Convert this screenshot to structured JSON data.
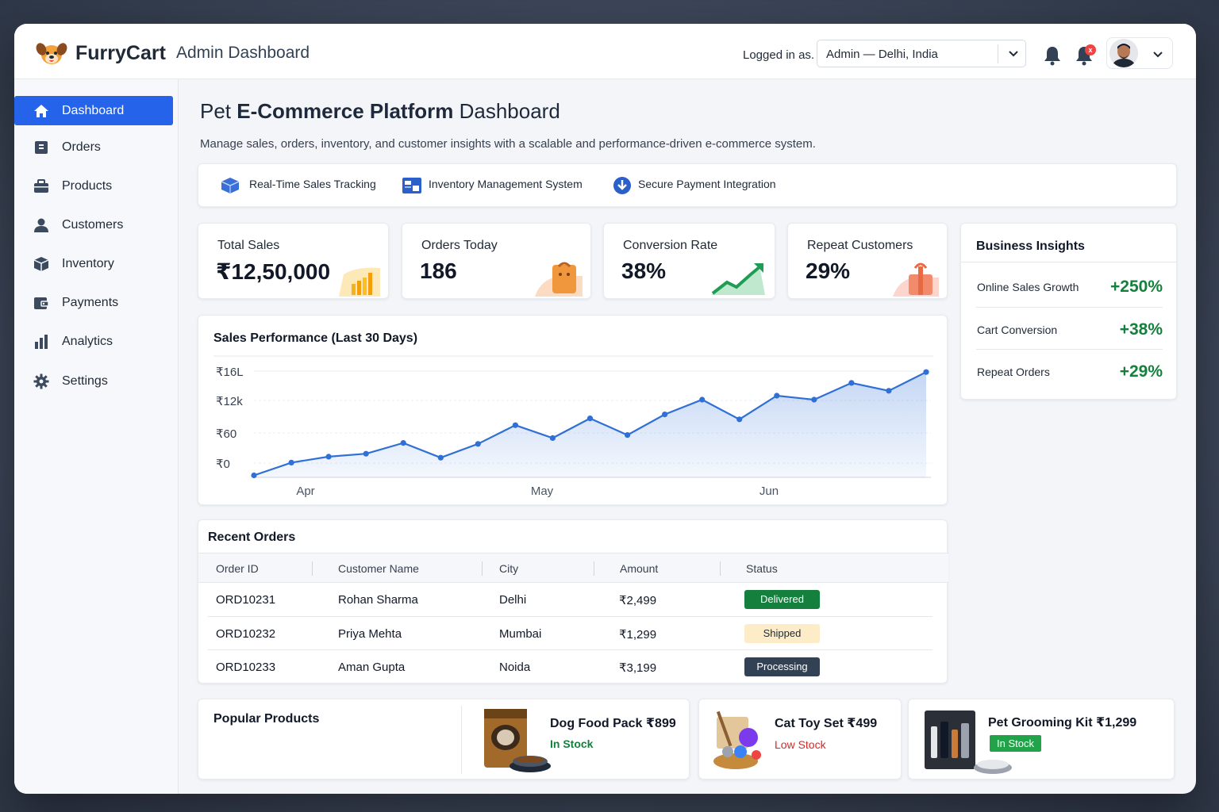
{
  "header": {
    "brand": "FurryCart",
    "subtitle": "Admin Dashboard",
    "logged_in_label": "Logged in as.",
    "location_value": "Admin — Delhi, India",
    "notification_badge": "x"
  },
  "sidebar": {
    "items": [
      {
        "label": "Dashboard",
        "icon": "home-icon",
        "active": true
      },
      {
        "label": "Orders",
        "icon": "orders-icon"
      },
      {
        "label": "Products",
        "icon": "briefcase-icon"
      },
      {
        "label": "Customers",
        "icon": "user-icon"
      },
      {
        "label": "Inventory",
        "icon": "box-icon"
      },
      {
        "label": "Payments",
        "icon": "wallet-icon"
      },
      {
        "label": "Analytics",
        "icon": "bar-chart-icon"
      },
      {
        "label": "Settings",
        "icon": "gear-icon"
      }
    ]
  },
  "page": {
    "title_prefix": "Pet",
    "title_bold": "E-Commerce Platform",
    "title_suffix": "Dashboard",
    "subtitle": "Manage sales, orders, inventory, and customer insights with a scalable and performance-driven e-commerce system."
  },
  "features": [
    {
      "label": "Real-Time Sales Tracking",
      "icon": "cube-icon"
    },
    {
      "label": "Inventory Management System",
      "icon": "inventory-icon"
    },
    {
      "label": "Secure Payment Integration",
      "icon": "download-circle-icon"
    }
  ],
  "kpis": [
    {
      "label": "Total Sales",
      "value": "₹12,50,000"
    },
    {
      "label": "Orders Today",
      "value": "186"
    },
    {
      "label": "Conversion Rate",
      "value": "38%"
    },
    {
      "label": "Repeat Customers",
      "value": "29%"
    }
  ],
  "insights": {
    "title": "Business Insights",
    "rows": [
      {
        "label": "Online Sales Growth",
        "value": "+250%"
      },
      {
        "label": "Cart Conversion",
        "value": "+38%"
      },
      {
        "label": "Repeat Orders",
        "value": "+29%"
      }
    ]
  },
  "chart_data": {
    "type": "area",
    "title": "Sales Performance (Last 30 Days)",
    "y_tick_labels": [
      "₹16L",
      "₹12k",
      "₹60",
      "₹0"
    ],
    "x_tick_labels": [
      "Apr",
      "May",
      "Jun"
    ],
    "grid": true,
    "series": [
      {
        "values": [
          0.2,
          1.5,
          2.1,
          2.4,
          3.5,
          2.0,
          3.4,
          5.3,
          4.0,
          6.0,
          4.3,
          6.4,
          7.9,
          5.9,
          8.3,
          7.9,
          9.6,
          8.8,
          10.7
        ]
      }
    ],
    "y_range": [
      0,
      10.8
    ],
    "accent_color": "#2f6fd6"
  },
  "orders": {
    "title": "Recent Orders",
    "columns": [
      "Order ID",
      "Customer Name",
      "City",
      "Amount",
      "Status"
    ],
    "rows": [
      {
        "id": "ORD10231",
        "customer": "Rohan Sharma",
        "city": "Delhi",
        "amount": "₹2,499",
        "status": "Delivered",
        "status_color": "#15803d"
      },
      {
        "id": "ORD10232",
        "customer": "Priya Mehta",
        "city": "Mumbai",
        "amount": "₹1,299",
        "status": "Shipped",
        "status_color": "#fdecc8"
      },
      {
        "id": "ORD10233",
        "customer": "Aman Gupta",
        "city": "Noida",
        "amount": "₹3,199",
        "status": "Processing",
        "status_color": "#334155"
      }
    ]
  },
  "popular": {
    "title": "Popular Products",
    "products": [
      {
        "name": "Dog Food Pack",
        "price": "₹899",
        "stock": "In Stock"
      },
      {
        "name": "Cat Toy Set",
        "price": "₹499",
        "stock": "Low Stock"
      },
      {
        "name": "Pet Grooming Kit",
        "price": "₹1,299",
        "stock": "In Stock"
      }
    ]
  }
}
